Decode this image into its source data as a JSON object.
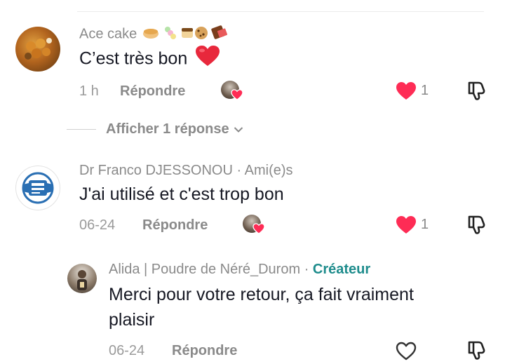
{
  "comments": [
    {
      "username": "Ace cake",
      "text": "C’est très bon",
      "time": "1 h",
      "reply_label": "Répondre",
      "likes": "1"
    },
    {
      "username": "Dr Franco DJESSONOU",
      "tag": "Ami(e)s",
      "text": "J'ai utilisé et c'est trop bon",
      "time": "06-24",
      "reply_label": "Répondre",
      "likes": "1"
    }
  ],
  "show_replies_label": "Afficher 1 réponse",
  "reply": {
    "username": "Alida | Poudre de Néré_Durom",
    "tag": "Créateur",
    "text_line1": "Merci pour votre retour, ça fait vraiment",
    "text_line2": "plaisir",
    "time": "06-24",
    "reply_label": "Répondre"
  },
  "colors": {
    "heart": "#fe2c55",
    "creator": "#1e8c8c",
    "muted": "#8a8a8a"
  },
  "icons": [
    "heart-filled-icon",
    "heart-outline-icon",
    "thumbs-down-icon",
    "chevron-down-icon",
    "heart-emoji-icon"
  ]
}
